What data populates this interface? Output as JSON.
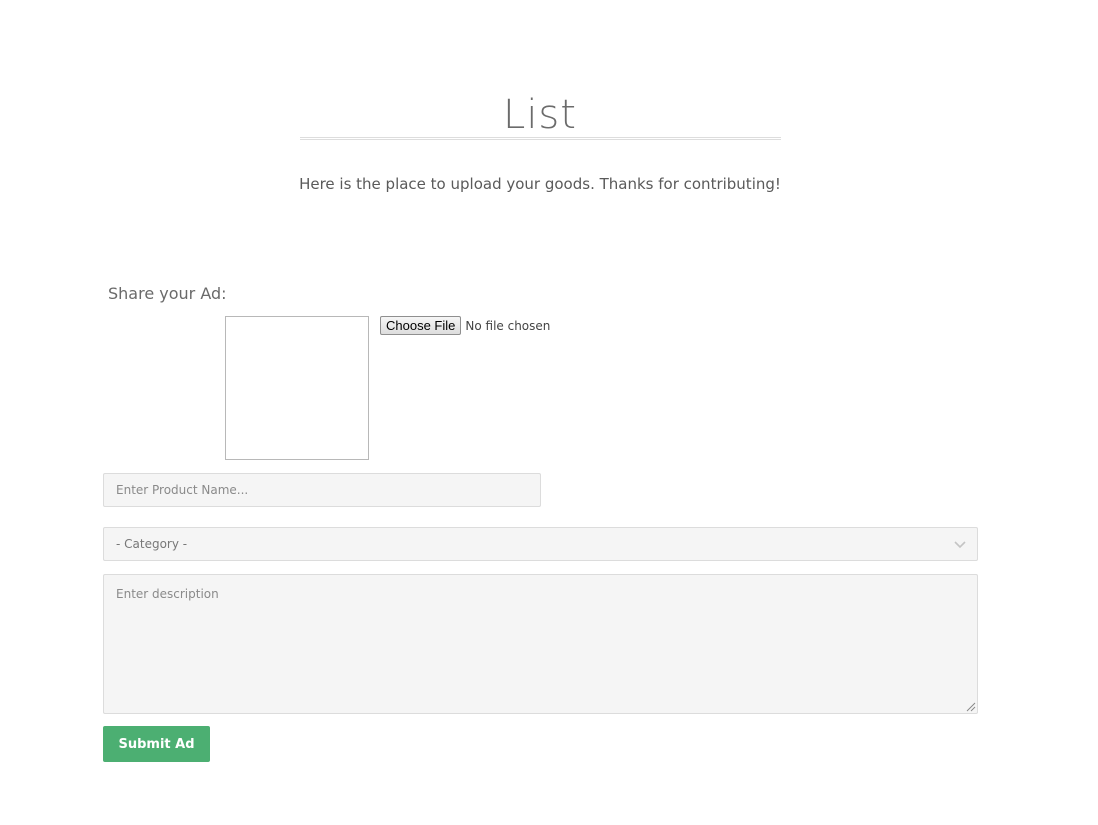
{
  "header": {
    "title": "List",
    "intro": "Here is the place to upload your goods. Thanks for contributing!"
  },
  "form": {
    "share_label": "Share your Ad:",
    "file_button_label": "Choose File",
    "file_status": "No file chosen",
    "product_name_placeholder": "Enter Product Name...",
    "category_selected": "- Category -",
    "description_placeholder": "Enter description",
    "submit_label": "Submit Ad"
  },
  "icons": {
    "category_dropdown": "chevron-down-icon"
  },
  "colors": {
    "submit_button": "#4caf72",
    "field_background": "#f5f5f5"
  }
}
